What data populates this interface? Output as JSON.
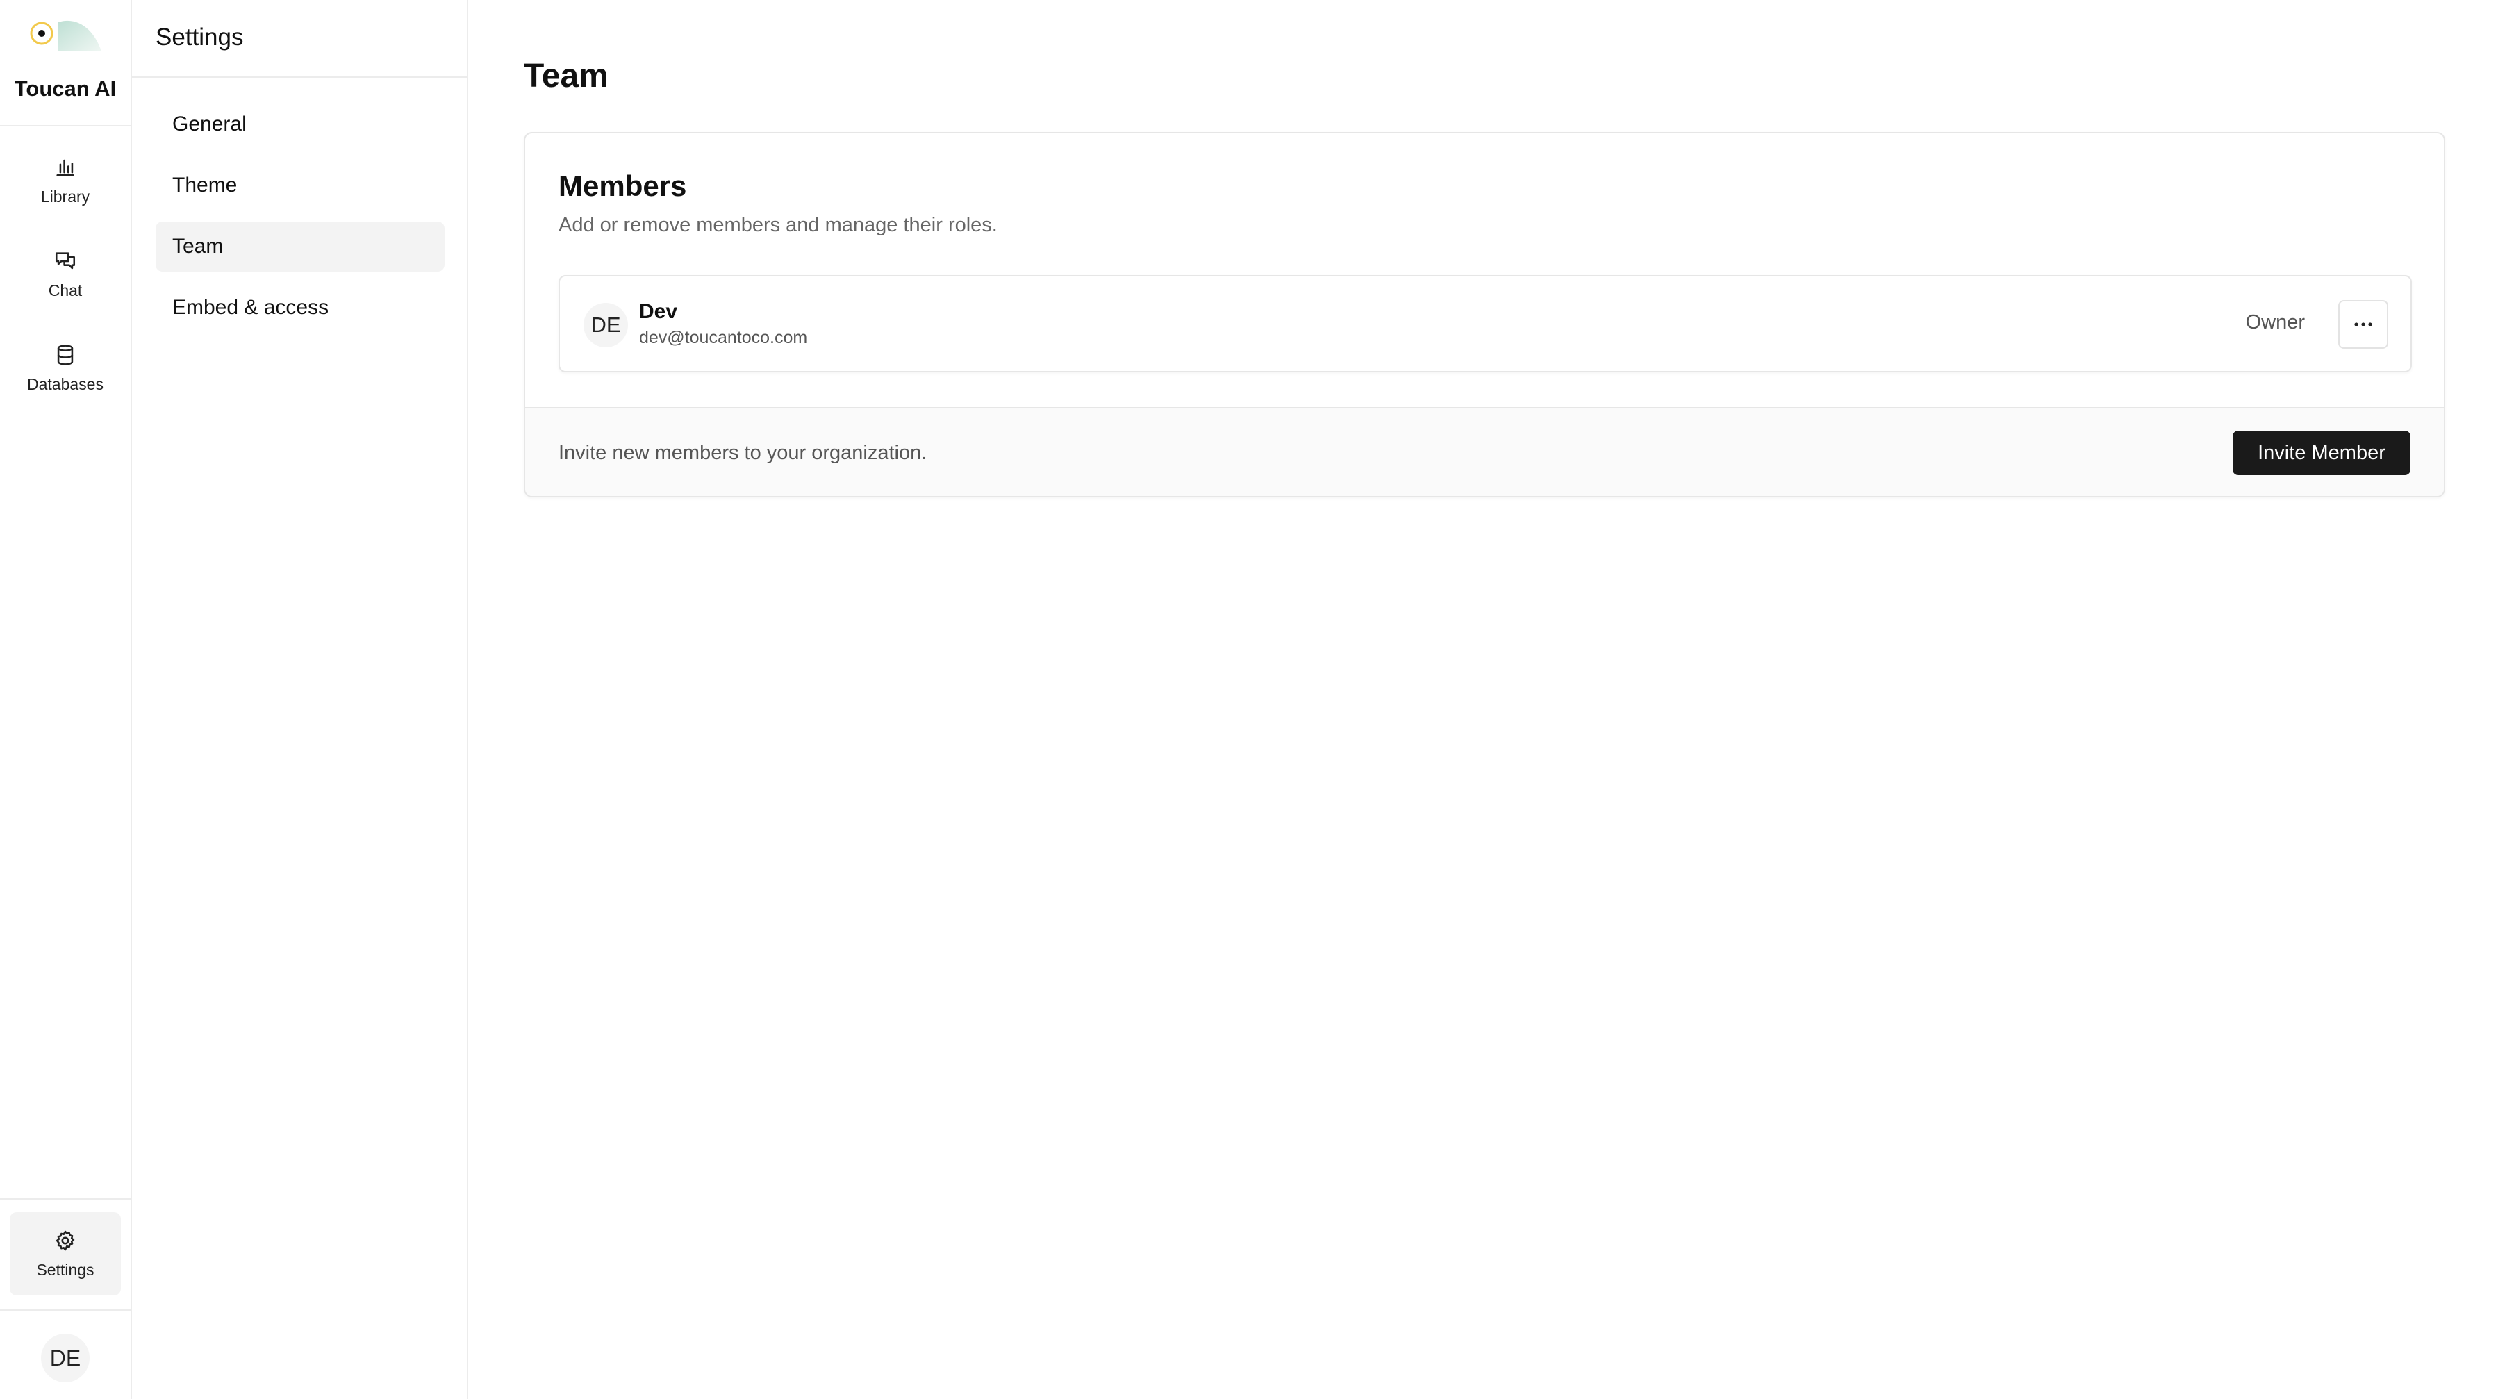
{
  "app": {
    "brand_name": "Toucan AI"
  },
  "rail": {
    "items": [
      {
        "label": "Library",
        "icon": "bar-chart-icon"
      },
      {
        "label": "Chat",
        "icon": "chat-bubbles-icon"
      },
      {
        "label": "Databases",
        "icon": "database-icon"
      }
    ],
    "settings": {
      "label": "Settings",
      "icon": "gear-icon"
    },
    "user_avatar": "DE"
  },
  "settings_nav": {
    "title": "Settings",
    "items": [
      {
        "label": "General"
      },
      {
        "label": "Theme"
      },
      {
        "label": "Team",
        "active": true
      },
      {
        "label": "Embed & access"
      }
    ]
  },
  "page": {
    "title": "Team"
  },
  "members_card": {
    "title": "Members",
    "description": "Add or remove members and manage their roles.",
    "members": [
      {
        "initials": "DE",
        "name": "Dev",
        "email": "dev@toucantoco.com",
        "role": "Owner"
      }
    ],
    "footer_text": "Invite new members to your organization.",
    "invite_label": "Invite Member"
  },
  "colors": {
    "accent_dark": "#1a1a1a",
    "logo_yellow": "#f2c94c",
    "logo_mint": "#cfe6de"
  }
}
